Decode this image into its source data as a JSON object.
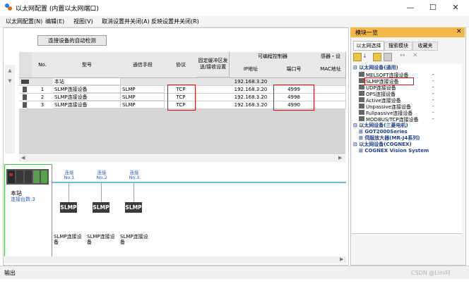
{
  "window": {
    "title": "以太网配置 (内置以太网端口)",
    "min": "—",
    "max": "☐",
    "close": "✕"
  },
  "menu": [
    "以太网配置(N)",
    "编辑(E)",
    "视图(V)",
    "取消设置并关闭(A)",
    "反映设置并关闭(R)"
  ],
  "toolbar": {
    "auto_detect": "连接设备的自动检测"
  },
  "grid": {
    "headers": {
      "no": "No.",
      "model": "型号",
      "comm": "通信手段",
      "protocol": "协议",
      "fixed": "固定缓冲区发送/接收设置",
      "plc_group": "可编程控制器",
      "ip": "IP地址",
      "port": "端口号",
      "sensor": "感器・设",
      "mac": "MAC地址"
    },
    "rows": [
      {
        "no": "",
        "model": "本站",
        "comm": "",
        "protocol": "",
        "fixed": "",
        "ip": "192.168.3.20",
        "port": "",
        "mac": ""
      },
      {
        "no": "1",
        "model": "SLMP连接设备",
        "comm": "SLMP",
        "protocol": "TCP",
        "fixed": "",
        "ip": "192.168.3.20",
        "port": "4999",
        "mac": ""
      },
      {
        "no": "2",
        "model": "SLMP连接设备",
        "comm": "SLMP",
        "protocol": "TCP",
        "fixed": "",
        "ip": "192.168.3.20",
        "port": "4998",
        "mac": ""
      },
      {
        "no": "3",
        "model": "SLMP连接设备",
        "comm": "SLMP",
        "protocol": "TCP",
        "fixed": "",
        "ip": "192.168.3.20",
        "port": "4990",
        "mac": ""
      }
    ]
  },
  "diagram": {
    "station_label": "本站",
    "station_sub": "连接台数:3",
    "links": [
      {
        "label1": "连接",
        "label2": "No.1",
        "block": "SLMP",
        "device": "SLMP连接设备"
      },
      {
        "label1": "连接",
        "label2": "No.2",
        "block": "SLMP",
        "device": "SLMP连接设备"
      },
      {
        "label1": "连接",
        "label2": "No.3",
        "block": "SLMP",
        "device": "SLMP连接设备"
      }
    ]
  },
  "module_panel": {
    "title": "模块一览",
    "close": "✕",
    "tabs": [
      "以太网选择",
      "搜索模块",
      "收藏夹"
    ],
    "groups": [
      {
        "label": "以太网设备(通用)",
        "items": [
          {
            "label": "MELSOFT连接设备",
            "value": "-"
          },
          {
            "label": "SLMP连接设备",
            "value": "-"
          },
          {
            "label": "UDP连接设备",
            "value": "-"
          },
          {
            "label": "OPS连接设备",
            "value": "-"
          },
          {
            "label": "Active连接设备",
            "value": "-"
          },
          {
            "label": "Unpassive连接设备",
            "value": "-"
          },
          {
            "label": "Fullpassive连接设备",
            "value": "-"
          },
          {
            "label": "MODBUS/TCP连接设备",
            "value": "-"
          }
        ]
      },
      {
        "label": "以太网设备(三菱电机)",
        "items": []
      },
      {
        "label": "GOT2000Series",
        "sub": true
      },
      {
        "label": "伺服放大器(MR-J4系列)",
        "sub": true
      },
      {
        "label": "以太网设备(COGNEX)",
        "items": []
      },
      {
        "label": "COGNEX Vision System",
        "sub": true
      }
    ]
  },
  "status": {
    "output": "输出"
  },
  "watermark": "CSDN @Lim叼"
}
